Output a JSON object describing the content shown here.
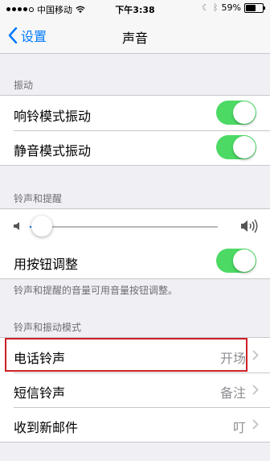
{
  "status_bar": {
    "carrier": "中国移动",
    "time": "下午3:38",
    "battery": "59%",
    "battery_level": 0.59
  },
  "nav": {
    "back_label": "设置",
    "title": "声音"
  },
  "sections": {
    "vibration": {
      "header": "振动",
      "rows": [
        {
          "label": "响铃模式振动",
          "toggle": true
        },
        {
          "label": "静音模式振动",
          "toggle": true
        }
      ]
    },
    "ringer": {
      "header": "铃声和提醒",
      "volume_level": 0.08,
      "adjust_label": "用按钮调整",
      "adjust_toggle": true,
      "footer": "铃声和提醒的音量可用音量按钮调整。"
    },
    "patterns": {
      "header": "铃声和振动模式",
      "rows": [
        {
          "label": "电话铃声",
          "value": "开场"
        },
        {
          "label": "短信铃声",
          "value": "备注"
        },
        {
          "label": "收到新邮件",
          "value": "叮"
        }
      ]
    }
  },
  "colors": {
    "accent": "#007aff",
    "toggle_on": "#4cd964",
    "highlight": "#cc2025"
  }
}
